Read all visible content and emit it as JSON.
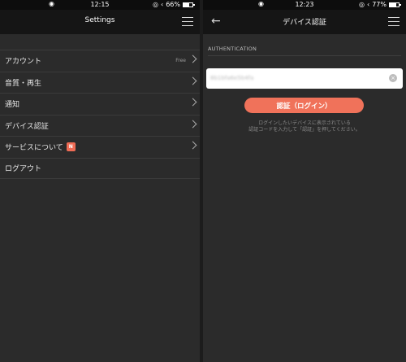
{
  "left": {
    "status": {
      "time": "12:15",
      "battery": "66%",
      "battery_level": 0.66
    },
    "header": {
      "title": "Settings"
    },
    "menu": [
      {
        "label": "アカウント",
        "detail": "Free"
      },
      {
        "label": "音質・再生"
      },
      {
        "label": "通知"
      },
      {
        "label": "デバイス認証"
      },
      {
        "label": "サービスについて",
        "badge": "N"
      },
      {
        "label": "ログアウト"
      }
    ]
  },
  "right": {
    "status": {
      "time": "12:23",
      "battery": "77%",
      "battery_level": 0.77
    },
    "header": {
      "title": "デバイス認証"
    },
    "section_label": "AUTHENTICATION",
    "input": {
      "value": "8b1bfa6e5b4fa",
      "placeholder": ""
    },
    "login_button": "認証（ログイン）",
    "instruction_line1": "ログインしたいデバイスに表示されている",
    "instruction_line2": "認証コードを入力して「認証」を押してください。"
  },
  "icons": {
    "wifi": "wifi-icon",
    "bluetooth": "bluetooth-icon",
    "lock": "orientation-lock-icon",
    "battery": "battery-icon",
    "menu": "hamburger-menu-icon",
    "back": "back-arrow-icon",
    "chevron": "chevron-right-icon",
    "clear": "clear-input-icon"
  },
  "colors": {
    "accent": "#f0725a",
    "background": "#2b2b2b",
    "header": "#151515"
  }
}
